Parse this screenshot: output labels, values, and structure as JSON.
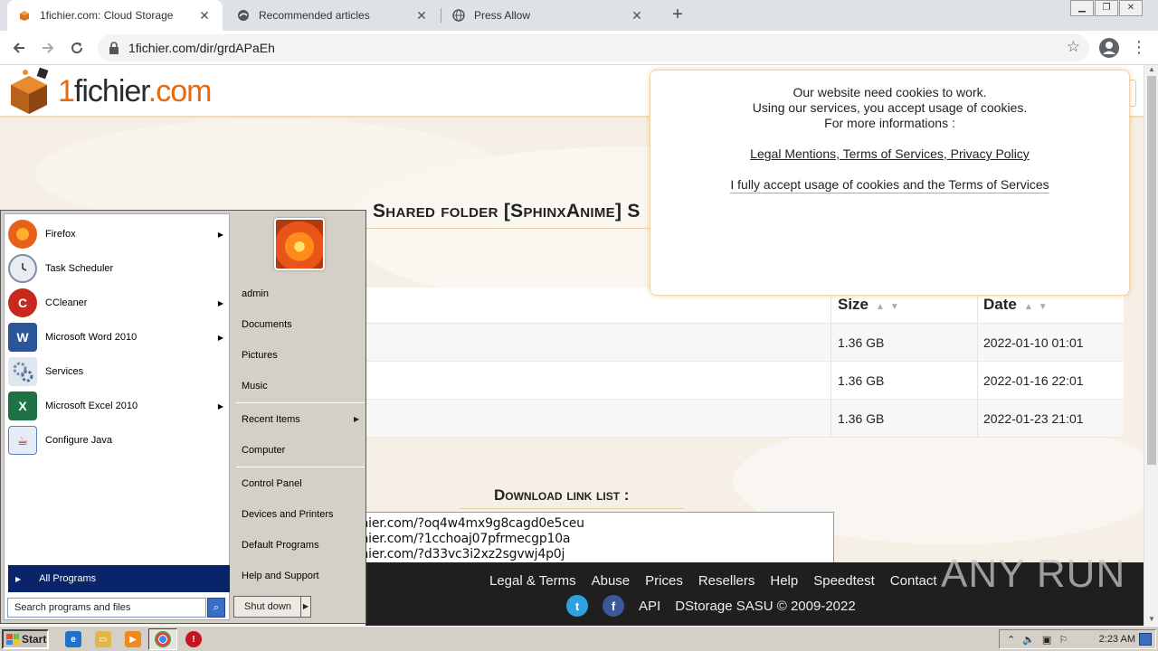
{
  "browser": {
    "tabs": [
      {
        "title": "1fichier.com: Cloud Storage",
        "icon": "orange-box-favicon",
        "active": true
      },
      {
        "title": "Recommended articles",
        "icon": "globe-bird-favicon",
        "active": false
      },
      {
        "title": "Press Allow",
        "icon": "globe-favicon",
        "active": false
      }
    ],
    "close_glyph": "✕",
    "newtab_glyph": "+",
    "url": "1fichier.com/dir/grdAPaEh"
  },
  "site": {
    "logo": {
      "one": "1",
      "fichier": "fichier",
      "dotcom": ".com"
    },
    "folder_title": "Shared folder [SphinxAnime] S",
    "table": {
      "headers": {
        "size": "Size",
        "date": "Date"
      },
      "rows": [
        {
          "size": "1.36 GB",
          "date": "2022-01-10 01:01"
        },
        {
          "size": "1.36 GB",
          "date": "2022-01-16 22:01"
        },
        {
          "size": "1.36 GB",
          "date": "2022-01-23 21:01"
        }
      ]
    },
    "download_title": "Download link list :",
    "download_links": [
      "chier.com/?oq4w4mx9g8cagd0e5ceu",
      "chier.com/?1cchoaj07pfrmecgp10a",
      "chier.com/?d33vc3i2xz2sgvwj4p0j"
    ],
    "footer": {
      "links": [
        "Legal & Terms",
        "Abuse",
        "Prices",
        "Resellers",
        "Help",
        "Speedtest",
        "Contact"
      ],
      "api": "API",
      "copyright": "DStorage SASU © 2009-2022"
    },
    "cookie": {
      "line1": "Our website need cookies to work.",
      "line2": "Using our services, you accept usage of cookies.",
      "line3": "For more informations :",
      "links": "Legal Mentions, Terms of Services, Privacy Policy",
      "accept": "I fully accept usage of cookies and the Terms of Services"
    }
  },
  "watermark": "ANY RUN",
  "start_menu": {
    "programs": [
      {
        "label": "Firefox",
        "icon": "firefox-icon",
        "color": "#e8601c",
        "submenu": true
      },
      {
        "label": "Task Scheduler",
        "icon": "clock-icon",
        "color": "#7d8fa8",
        "submenu": false
      },
      {
        "label": "CCleaner",
        "icon": "ccleaner-icon",
        "color": "#c8281e",
        "submenu": true
      },
      {
        "label": "Microsoft Word 2010",
        "icon": "word-icon",
        "color": "#2a5699",
        "submenu": true
      },
      {
        "label": "Services",
        "icon": "gears-icon",
        "color": "#6f8fb3",
        "submenu": false
      },
      {
        "label": "Microsoft Excel 2010",
        "icon": "excel-icon",
        "color": "#1f7244",
        "submenu": true
      },
      {
        "label": "Configure Java",
        "icon": "java-icon",
        "color": "#5a7fb5",
        "submenu": false
      }
    ],
    "all_programs": "All Programs",
    "search_placeholder": "Search programs and files",
    "right_items": [
      "admin",
      "Documents",
      "Pictures",
      "Music",
      "Recent Items",
      "Computer",
      "Control Panel",
      "Devices and Printers",
      "Default Programs",
      "Help and Support"
    ],
    "shutdown": "Shut down"
  },
  "taskbar": {
    "start": "Start",
    "clock": "2:23 AM"
  }
}
